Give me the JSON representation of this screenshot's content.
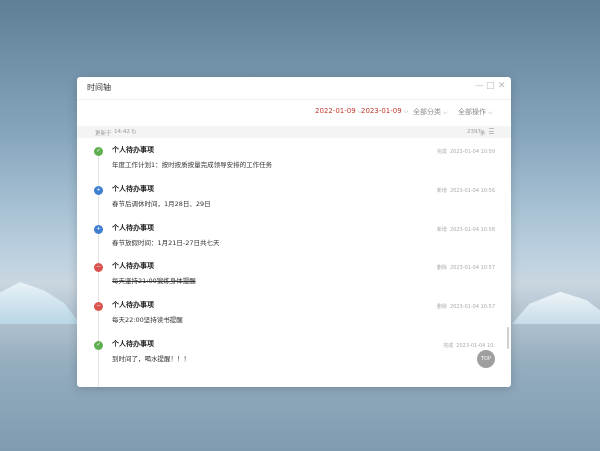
{
  "window": {
    "title": "时间轴"
  },
  "window_controls": {
    "minimize": "—",
    "maximize": "□",
    "close": "✕"
  },
  "toolbar": {
    "start_date": "2022-01-09",
    "end_date": "2023-01-09",
    "category": "全部分类",
    "operation": "全部操作",
    "chevron": "⌵"
  },
  "infobar": {
    "update_label": "更新于",
    "update_time": "14:42",
    "refresh_glyph": "↻",
    "count": "2397",
    "count_unit": "条"
  },
  "items": [
    {
      "title": "个人待办事项",
      "desc": "年度工作计划1：按时按质按量完成领导安排的工作任务",
      "status": "完成",
      "time": "2023-01-04 10:59",
      "dot": "green",
      "icon": "check-icon",
      "glyph": "✓",
      "strike": false
    },
    {
      "title": "个人待办事项",
      "desc": "春节后调休时间，1月28日、29日",
      "status": "新增",
      "time": "2023-01-04 10:56",
      "dot": "blue",
      "icon": "plus-icon",
      "glyph": "+",
      "strike": false
    },
    {
      "title": "个人待办事项",
      "desc": "春节放假时间：1月21日-27日共七天",
      "status": "新增",
      "time": "2023-01-04 10:58",
      "dot": "blue",
      "icon": "plus-icon",
      "glyph": "+",
      "strike": false
    },
    {
      "title": "个人待办事项",
      "desc": "每天坚持21:00锻炼身体提醒",
      "status": "删除",
      "time": "2023-01-04 10:57",
      "dot": "red",
      "icon": "delete-icon",
      "glyph": "−",
      "strike": true
    },
    {
      "title": "个人待办事项",
      "desc": "每天22:00坚持读书提醒",
      "status": "删除",
      "time": "2023-01-04 10:57",
      "dot": "red",
      "icon": "delete-icon",
      "glyph": "−",
      "strike": false
    },
    {
      "title": "个人待办事项",
      "desc": "到时间了，喝水提醒！！！",
      "status": "完成",
      "time": "2023-01-04 10:",
      "dot": "green",
      "icon": "check-icon",
      "glyph": "✓",
      "strike": false
    }
  ],
  "top_button": "TOP",
  "colors": {
    "accent_date": "#c0392b",
    "complete": "#5fae4f",
    "add": "#3f7fd0",
    "delete": "#d9534f"
  }
}
